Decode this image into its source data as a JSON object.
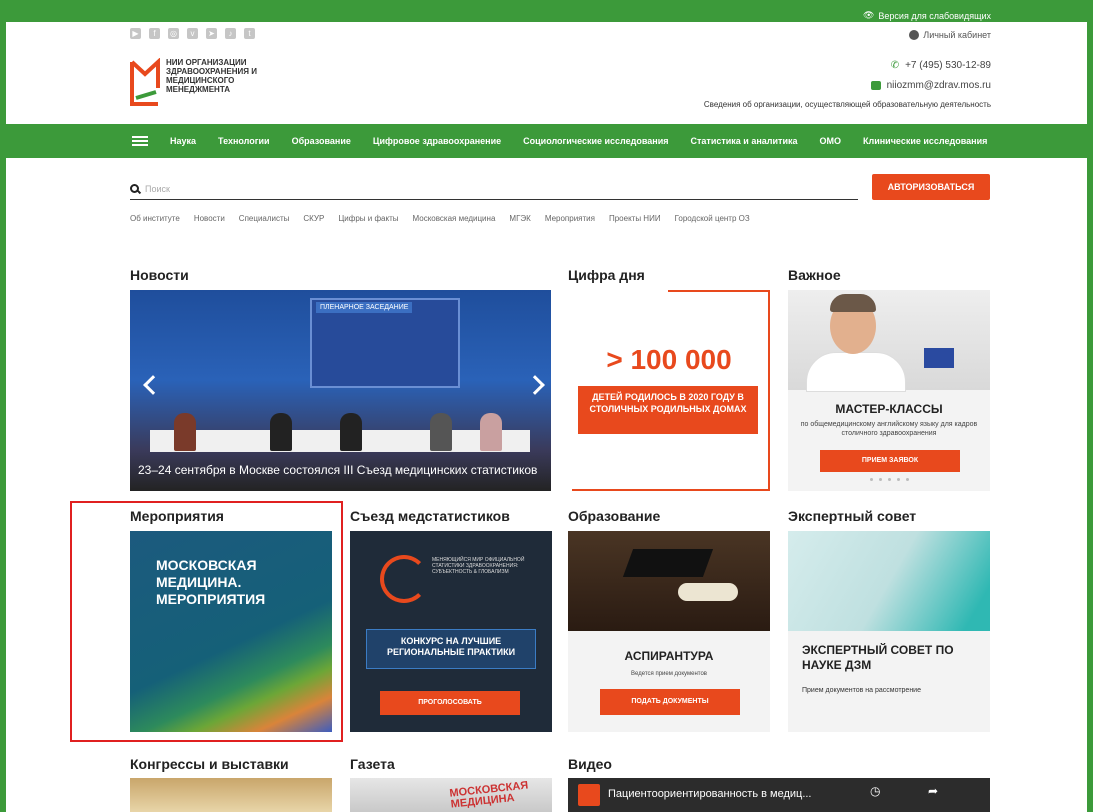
{
  "top_bar": {
    "accessible_label": "Версия для слабовидящих",
    "cabinet_label": "Личный кабинет"
  },
  "social_icons": [
    "youtube-icon",
    "facebook-icon",
    "instagram-icon",
    "vk-icon",
    "telegram-icon",
    "tiktok-icon",
    "twitter-icon"
  ],
  "logo": {
    "text": "НИИ ОРГАНИЗАЦИИ ЗДРАВООХРАНЕНИЯ И МЕДИЦИНСКОГО МЕНЕДЖМЕНТА"
  },
  "contacts": {
    "phone": "+7 (495) 530-12-89",
    "email": "niiozmm@zdrav.mos.ru",
    "info_link": "Сведения об организации, осуществляющей образовательную деятельность"
  },
  "nav": {
    "items": [
      "Наука",
      "Технологии",
      "Образование",
      "Цифровое здравоохранение",
      "Социологические исследования",
      "Статистика и аналитика",
      "ОМО",
      "Клинические исследования"
    ]
  },
  "search": {
    "placeholder": "Поиск",
    "auth_button": "АВТОРИЗОВАТЬСЯ"
  },
  "sublinks": [
    "Об институте",
    "Новости",
    "Специалисты",
    "СКУР",
    "Цифры и факты",
    "Московская медицина",
    "МГЭК",
    "Мероприятия",
    "Проекты НИИ",
    "Городской центр ОЗ"
  ],
  "sections": {
    "news": {
      "title": "Новости",
      "screen_label": "ПЛЕНАРНОЕ ЗАСЕДАНИЕ",
      "caption": "23–24 сентября в Москве состоялся III Съезд медицинских статистиков"
    },
    "digit": {
      "title": "Цифра дня",
      "number": "> 100 000",
      "text": "ДЕТЕЙ РОДИЛОСЬ В 2020 ГОДУ В СТОЛИЧНЫХ РОДИЛЬНЫХ ДОМАХ"
    },
    "important": {
      "title": "Важное",
      "card_title": "МАСТЕР-КЛАССЫ",
      "card_desc": "по общемедицинскому английскому языку для кадров столичного здравоохранения",
      "button": "ПРИЕМ ЗАЯВОК"
    },
    "events": {
      "title": "Мероприятия",
      "card_title": "МОСКОВСКАЯ МЕДИЦИНА. МЕРОПРИЯТИЯ"
    },
    "congress": {
      "title": "Съезд медстатистиков",
      "ring_text": "МЕНЯЮЩИЙСЯ МИР ОФИЦИАЛЬНОЙ СТАТИСТИКИ ЗДРАВООХРАНЕНИЯ: СУБЪЕКТНОСТЬ & ГЛОБАЛИЗМ",
      "box_text": "КОНКУРС НА ЛУЧШИЕ РЕГИОНАЛЬНЫЕ ПРАКТИКИ",
      "button": "ПРОГОЛОСОВАТЬ"
    },
    "education": {
      "title": "Образование",
      "card_title": "АСПИРАНТУРА",
      "card_desc": "Ведется прием документов",
      "button": "ПОДАТЬ ДОКУМЕНТЫ"
    },
    "expert": {
      "title": "Экспертный совет",
      "card_title": "ЭКСПЕРТНЫЙ СОВЕТ ПО НАУКЕ ДЗМ",
      "card_desc": "Прием документов на рассмотрение"
    },
    "congresses": {
      "title": "Конгрессы и выставки"
    },
    "newspaper": {
      "title": "Газета",
      "label": "МОСКОВСКАЯ МЕДИЦИНА"
    },
    "video": {
      "title": "Видео",
      "video_title": "Пациентоориентированность в медиц..."
    }
  },
  "colors": {
    "brand_green": "#3c9a3a",
    "accent_orange": "#e8491d",
    "highlight_red": "#e02020"
  }
}
